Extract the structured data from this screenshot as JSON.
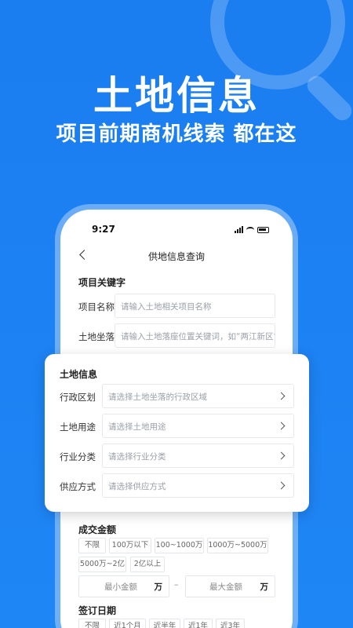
{
  "banner": {
    "headline": "土地信息",
    "subline": "项目前期商机线索 都在这"
  },
  "status_bar": {
    "time": "9:27"
  },
  "nav": {
    "title": "供地信息查询"
  },
  "keywords_section": {
    "title": "项目关键字",
    "fields": [
      {
        "label": "项目名称",
        "placeholder": "请输入土地相关项目名称"
      },
      {
        "label": "土地坐落",
        "placeholder": "请输入土地落座位置关键词，如“两江新区”"
      }
    ]
  },
  "land_info": {
    "title": "土地信息",
    "fields": [
      {
        "label": "行政区划",
        "placeholder": "请选择土地坐落的行政区域"
      },
      {
        "label": "土地用途",
        "placeholder": "请选择土地用途"
      },
      {
        "label": "行业分类",
        "placeholder": "请选择行业分类"
      },
      {
        "label": "供应方式",
        "placeholder": "请选择供应方式"
      }
    ]
  },
  "deal_amount": {
    "title": "成交金额",
    "options": [
      "不限",
      "100万以下",
      "100~1000万",
      "1000万~5000万",
      "5000万~2亿",
      "2亿以上"
    ],
    "min_placeholder": "最小金额",
    "max_placeholder": "最大金额",
    "unit": "万",
    "separator": "–"
  },
  "sign_date": {
    "title": "签订日期",
    "options": [
      "不限",
      "近1个月",
      "近半年",
      "近1年",
      "近3年"
    ]
  }
}
